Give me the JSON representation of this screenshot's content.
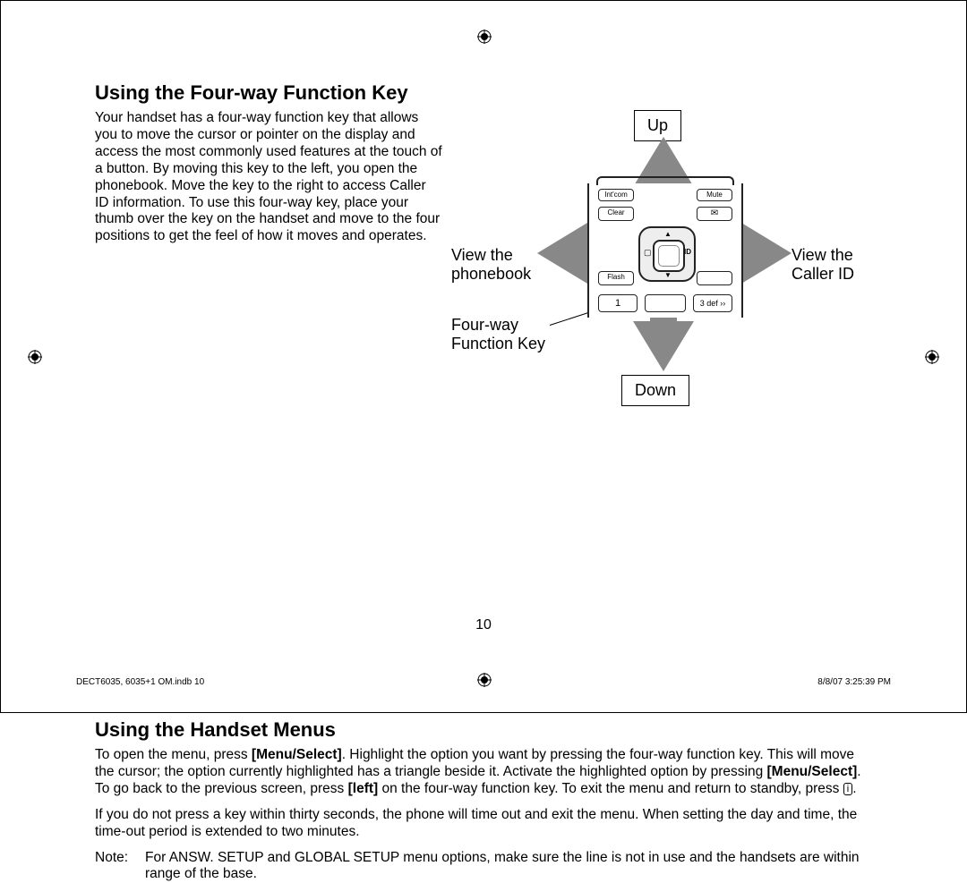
{
  "section1": {
    "heading": "Using the Four-way Function Key",
    "body": "Your handset has a four-way function key that allows you to move the cursor or pointer on the display and access the most commonly used features at the touch of a button. By moving this key to the left, you open the phonebook. Move the key to the right to access Caller ID information. To use this four-way key, place your thumb over the key on the handset and move to the four positions to get the feel of how it moves and operates."
  },
  "diagram": {
    "up": "Up",
    "down": "Down",
    "left_line1": "View the",
    "left_line2": "phonebook",
    "right_line1": "View the",
    "right_line2": "Caller ID",
    "center_line1": "Four-way",
    "center_line2": "Function Key",
    "keys": {
      "intcom": "Int'com",
      "mute": "Mute",
      "clear": "Clear",
      "mail": "✉",
      "flash": "Flash",
      "one": "1",
      "three": "3 def ››",
      "book": "▢",
      "id": "ID"
    }
  },
  "section2": {
    "heading": "Using the Handset Menus",
    "p1a": "To open the menu, press ",
    "p1b": ". Highlight the option you want by pressing the four-way function key. This will move the cursor;  the option currently highlighted has a triangle beside it. Activate the highlighted option by pressing ",
    "p1c": ". To go back to the previous screen, press ",
    "p1d": " on the four-way function key. To exit the menu and return to standby, press ",
    "p1e": ".",
    "menu_select": "[Menu/Select]",
    "left": "[left]",
    "end_key": "i",
    "p2": "If you do not press a key within thirty seconds, the phone will time out and exit the menu. When setting the day and time, the time-out period is extended to two minutes.",
    "note_label": "Note:",
    "note_body": "For ANSW. SETUP and GLOBAL SETUP menu options, make sure the line is not in use and the handsets are within range of the base."
  },
  "page_number": "10",
  "footer_left": "DECT6035, 6035+1 OM.indb   10",
  "footer_right": "8/8/07   3:25:39 PM"
}
